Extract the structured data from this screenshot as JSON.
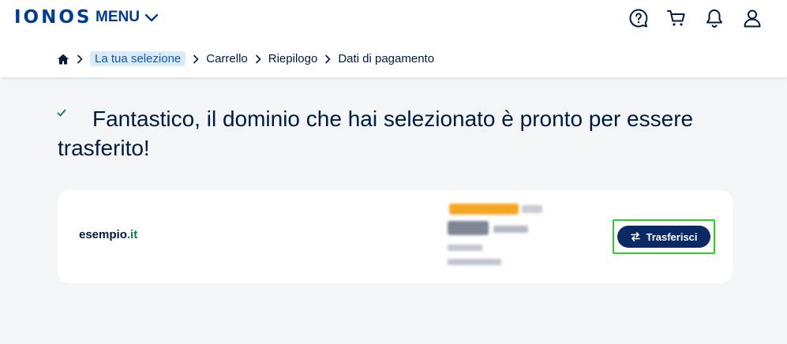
{
  "header": {
    "logo": "IONOS",
    "menu_label": "MENU",
    "icons": [
      "help-icon",
      "cart-icon",
      "bell-icon",
      "user-icon"
    ]
  },
  "breadcrumb": {
    "home_icon": "home-icon",
    "items": [
      "La tua selezione",
      "Carrello",
      "Riepilogo",
      "Dati di pagamento"
    ],
    "active_index": 0
  },
  "main": {
    "check_icon": "check-icon",
    "headline": "Fantastico, il dominio che hai selezionato è pronto per essere trasferito!"
  },
  "card": {
    "domain_name": "esempio",
    "domain_tld": ".it",
    "price_blurred": true,
    "transfer_button": {
      "label": "Trasferisci",
      "icon": "transfer-arrows-icon"
    }
  },
  "colors": {
    "brand_blue": "#003d8f",
    "button_bg": "#0b2a63",
    "highlight_frame": "#2dcc2d",
    "promo_badge": "#f5a623",
    "page_bg": "#f4f5f7"
  }
}
